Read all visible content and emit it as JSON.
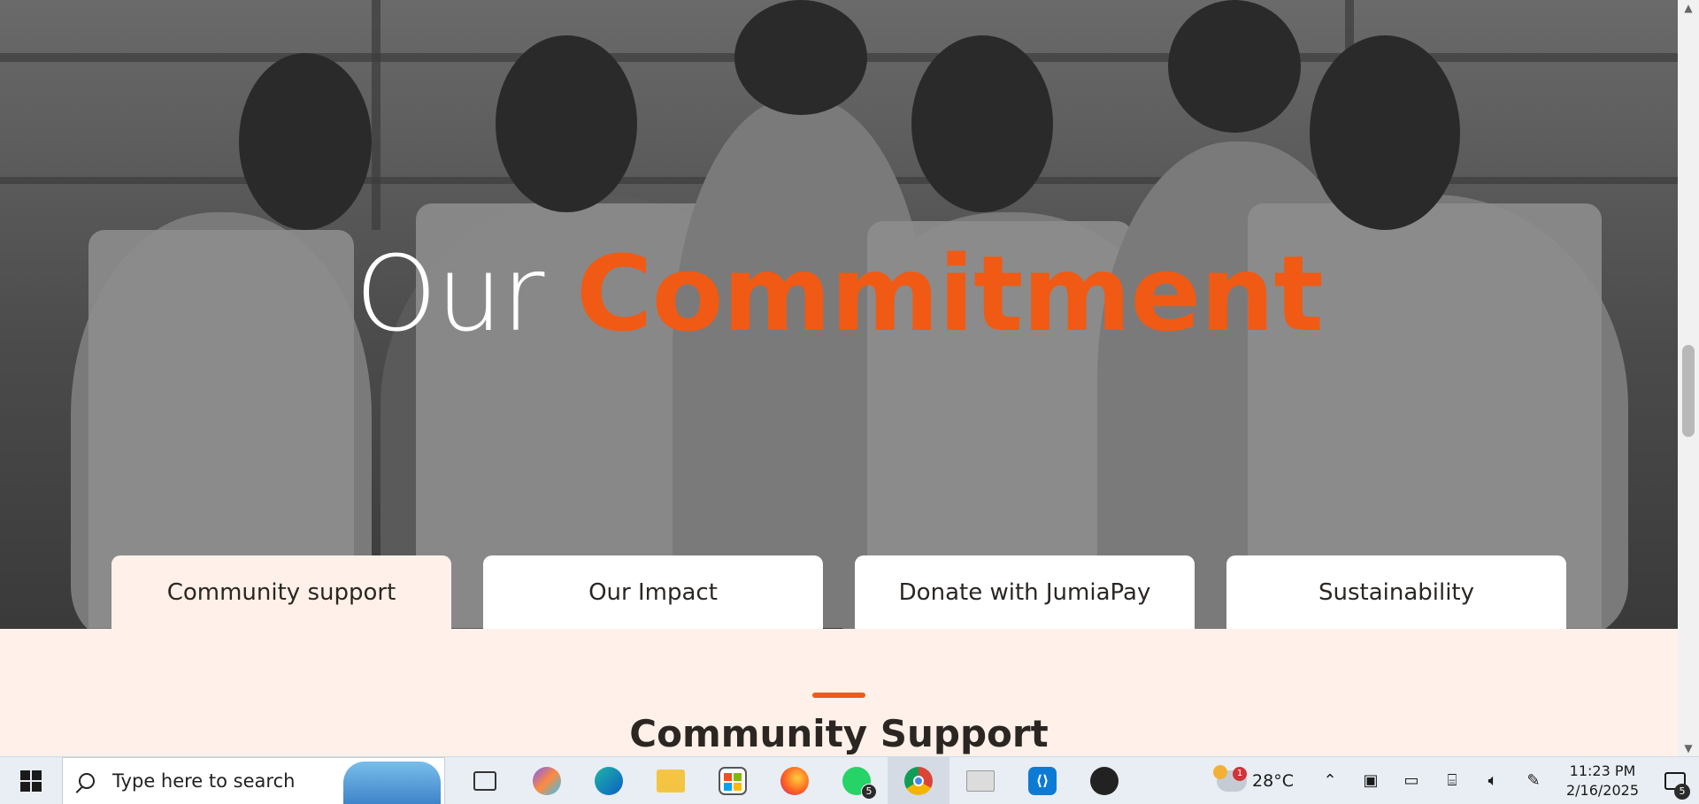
{
  "hero": {
    "title_part1": "Our",
    "title_part2": "Commitment",
    "accent_color": "#f05a14"
  },
  "tabs": [
    {
      "label": "Community support",
      "active": true
    },
    {
      "label": "Our Impact",
      "active": false
    },
    {
      "label": "Donate with JumiaPay",
      "active": false
    },
    {
      "label": "Sustainability",
      "active": false
    }
  ],
  "section": {
    "title": "Community Support"
  },
  "taskbar": {
    "search_placeholder": "Type here to search",
    "apps": [
      {
        "icon": "task-view-icon"
      },
      {
        "icon": "copilot-icon"
      },
      {
        "icon": "edge-icon"
      },
      {
        "icon": "file-explorer-icon"
      },
      {
        "icon": "microsoft-store-icon"
      },
      {
        "icon": "firefox-icon"
      },
      {
        "icon": "whatsapp-icon",
        "badge": "5"
      },
      {
        "icon": "chrome-icon"
      },
      {
        "icon": "mail-icon"
      },
      {
        "icon": "vscode-icon"
      },
      {
        "icon": "app-icon"
      }
    ],
    "weather": {
      "temp": "28°C",
      "badge": "1"
    },
    "clock": {
      "time": "11:23 PM",
      "date": "2/16/2025"
    },
    "notifications_badge": "5"
  }
}
